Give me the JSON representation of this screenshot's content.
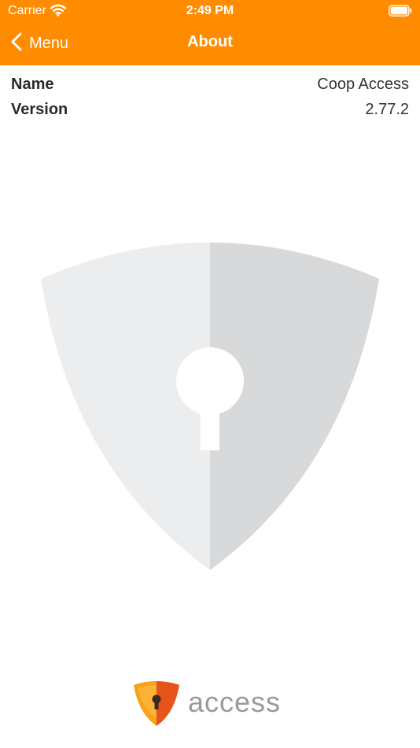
{
  "status_bar": {
    "carrier": "Carrier",
    "time": "2:49 PM",
    "icons": [
      "wifi-icon",
      "battery-icon"
    ]
  },
  "nav_bar": {
    "back_label": "Menu",
    "title": "About",
    "background_color": "#ff8c00",
    "back_icon": "chevron-left-icon"
  },
  "info": {
    "name_label": "Name",
    "name_value": "Coop Access",
    "version_label": "Version",
    "version_value": "2.77.2"
  },
  "graphics": {
    "hero_icon": "shield-keyhole-icon",
    "shield_left_color": "#ecedee",
    "shield_right_color": "#d8d9db"
  },
  "brand": {
    "wordmark": "access",
    "logo_icon": "shield-keyhole-logo-icon",
    "logo_colors": [
      "#f7a21b",
      "#e8531b"
    ]
  }
}
